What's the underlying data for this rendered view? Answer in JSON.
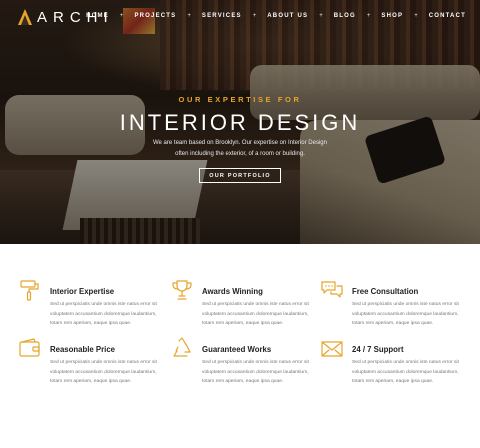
{
  "brand": {
    "name": "ARCHI",
    "accent_color": "#e7a42a"
  },
  "nav": {
    "items": [
      "HOME",
      "PROJECTS",
      "SERVICES",
      "ABOUT US",
      "BLOG",
      "SHOP",
      "CONTACT"
    ],
    "separator": "+"
  },
  "hero": {
    "subtitle": "OUR EXPERTISE FOR",
    "title": "INTERIOR DESIGN",
    "description_line1": "We are team based on Brooklyn. Our expertise on Interior Design",
    "description_line2": "often including the exterior, of a room or building.",
    "button_label": "OUR PORTFOLIO"
  },
  "features": [
    {
      "title": "Interior Expertise",
      "icon": "paint-roller-icon",
      "line1": "Sed ut perspiciatis unde omnis iste natus error sit",
      "line2": "voluptatem accusantium doloremque laudantium,",
      "line3": "totam rem aperiam, eaque ipsa quae."
    },
    {
      "title": "Awards Winning",
      "icon": "trophy-icon",
      "line1": "Sed ut perspiciatis unde omnis iste natus error sit",
      "line2": "voluptatem accusantium doloremque laudantium,",
      "line3": "totam rem aperiam, eaque ipsa quae."
    },
    {
      "title": "Free Consultation",
      "icon": "chat-bubbles-icon",
      "line1": "Sed ut perspiciatis unde omnis iste natus error sit",
      "line2": "voluptatem accusantium doloremque laudantium,",
      "line3": "totam rem aperiam, eaque ipsa quae."
    },
    {
      "title": "Reasonable Price",
      "icon": "wallet-icon",
      "line1": "Sed ut perspiciatis unde omnis iste natus error sit",
      "line2": "voluptatem accusantium doloremque laudantium,",
      "line3": "totam rem aperiam, eaque ipsa quae."
    },
    {
      "title": "Guaranteed Works",
      "icon": "recycle-icon",
      "line1": "Sed ut perspiciatis unde omnis iste natus error sit",
      "line2": "voluptatem accusantium doloremque laudantium,",
      "line3": "totam rem aperiam, eaque ipsa quae."
    },
    {
      "title": "24 / 7 Support",
      "icon": "envelope-icon",
      "line1": "Sed ut perspiciatis unde omnis iste natus error sit",
      "line2": "voluptatem accusantium doloremque laudantium,",
      "line3": "totam rem aperiam, eaque ipsa quae."
    }
  ]
}
